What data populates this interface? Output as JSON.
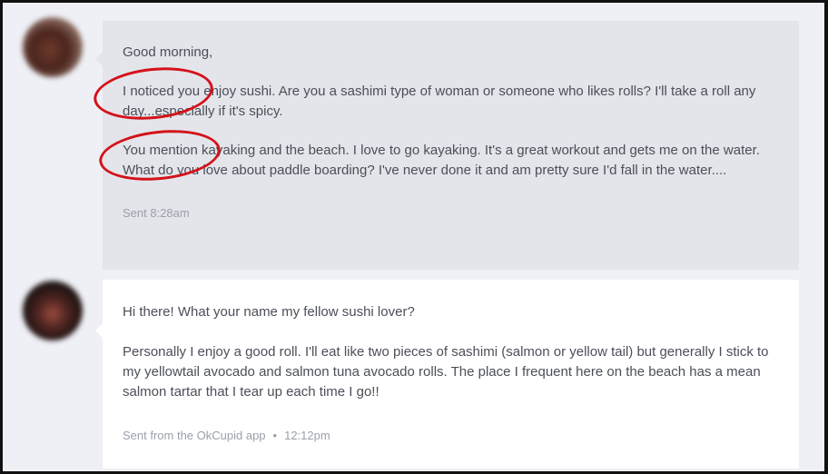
{
  "messages": [
    {
      "greeting": "Good morning,",
      "para1": "I noticed you enjoy sushi. Are you a sashimi type of woman or someone who likes rolls? I'll take a roll any day...especially if it's spicy.",
      "para2": "You mention kayaking and the beach. I love to go kayaking. It's a great workout and gets me on the water. What do you love about paddle boarding? I've never done it and am pretty sure I'd fall in the water....",
      "status": "Sent 8:28am"
    },
    {
      "greeting": "Hi there! What your name my fellow sushi lover?",
      "para1": "Personally I enjoy a good roll. I'll eat like two pieces of sashimi (salmon or yellow tail) but generally I stick to my yellowtail avocado and salmon tuna avocado rolls. The place I frequent here on the beach has a mean salmon tartar that I tear up each time I go!!",
      "source": "Sent from the OkCupid app",
      "separator": "•",
      "time": "12:12pm"
    }
  ],
  "colors": {
    "annotation": "#d4111a",
    "sent_bubble": "#e3e5ea",
    "received_bubble": "#ffffff",
    "page_background": "#eef0f6"
  }
}
